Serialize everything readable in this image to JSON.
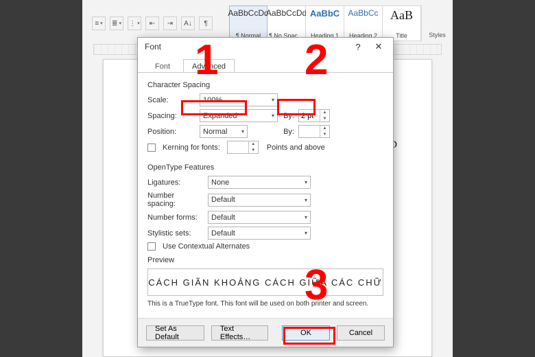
{
  "ribbon": {
    "styles": [
      {
        "sample": "AaBbCcDd",
        "label": "¶ Normal",
        "cls": ""
      },
      {
        "sample": "AaBbCcDd",
        "label": "¶ No Spac…",
        "cls": ""
      },
      {
        "sample": "AaBbC",
        "label": "Heading 1",
        "cls": "h1"
      },
      {
        "sample": "AaBbCc",
        "label": "Heading 2",
        "cls": "h2"
      },
      {
        "sample": "AaB",
        "label": "Title",
        "cls": "title"
      }
    ],
    "styles_caption": "Styles"
  },
  "page": {
    "trailing_char": "D"
  },
  "dialog": {
    "title": "Font",
    "help": "?",
    "close": "✕",
    "tabs": {
      "font": "Font",
      "advanced": "Advanced"
    },
    "char_spacing": {
      "title": "Character Spacing",
      "scale_label": "Scale:",
      "scale_value": "100%",
      "spacing_label": "Spacing:",
      "spacing_value": "Expanded",
      "by_label": "By:",
      "by_value": "2 pt",
      "position_label": "Position:",
      "position_value": "Normal",
      "by2_label": "By:",
      "by2_value": "",
      "kerning_label": "Kerning for fonts:",
      "kerning_after": "Points and above"
    },
    "opentype": {
      "title": "OpenType Features",
      "ligatures_label": "Ligatures:",
      "ligatures_value": "None",
      "numspacing_label": "Number spacing:",
      "numspacing_value": "Default",
      "numforms_label": "Number forms:",
      "numforms_value": "Default",
      "stylistic_label": "Stylistic sets:",
      "stylistic_value": "Default",
      "contextual_label": "Use Contextual Alternates"
    },
    "preview": {
      "title": "Preview",
      "text": "CÁCH GIÃN KHOẢNG CÁCH GIỮA CÁC CHỮ",
      "hint": "This is a TrueType font. This font will be used on both printer and screen."
    },
    "footer": {
      "set_default": "Set As Default",
      "text_effects": "Text Effects…",
      "ok": "OK",
      "cancel": "Cancel"
    }
  },
  "annotations": {
    "one": "1",
    "two": "2",
    "three": "3"
  }
}
